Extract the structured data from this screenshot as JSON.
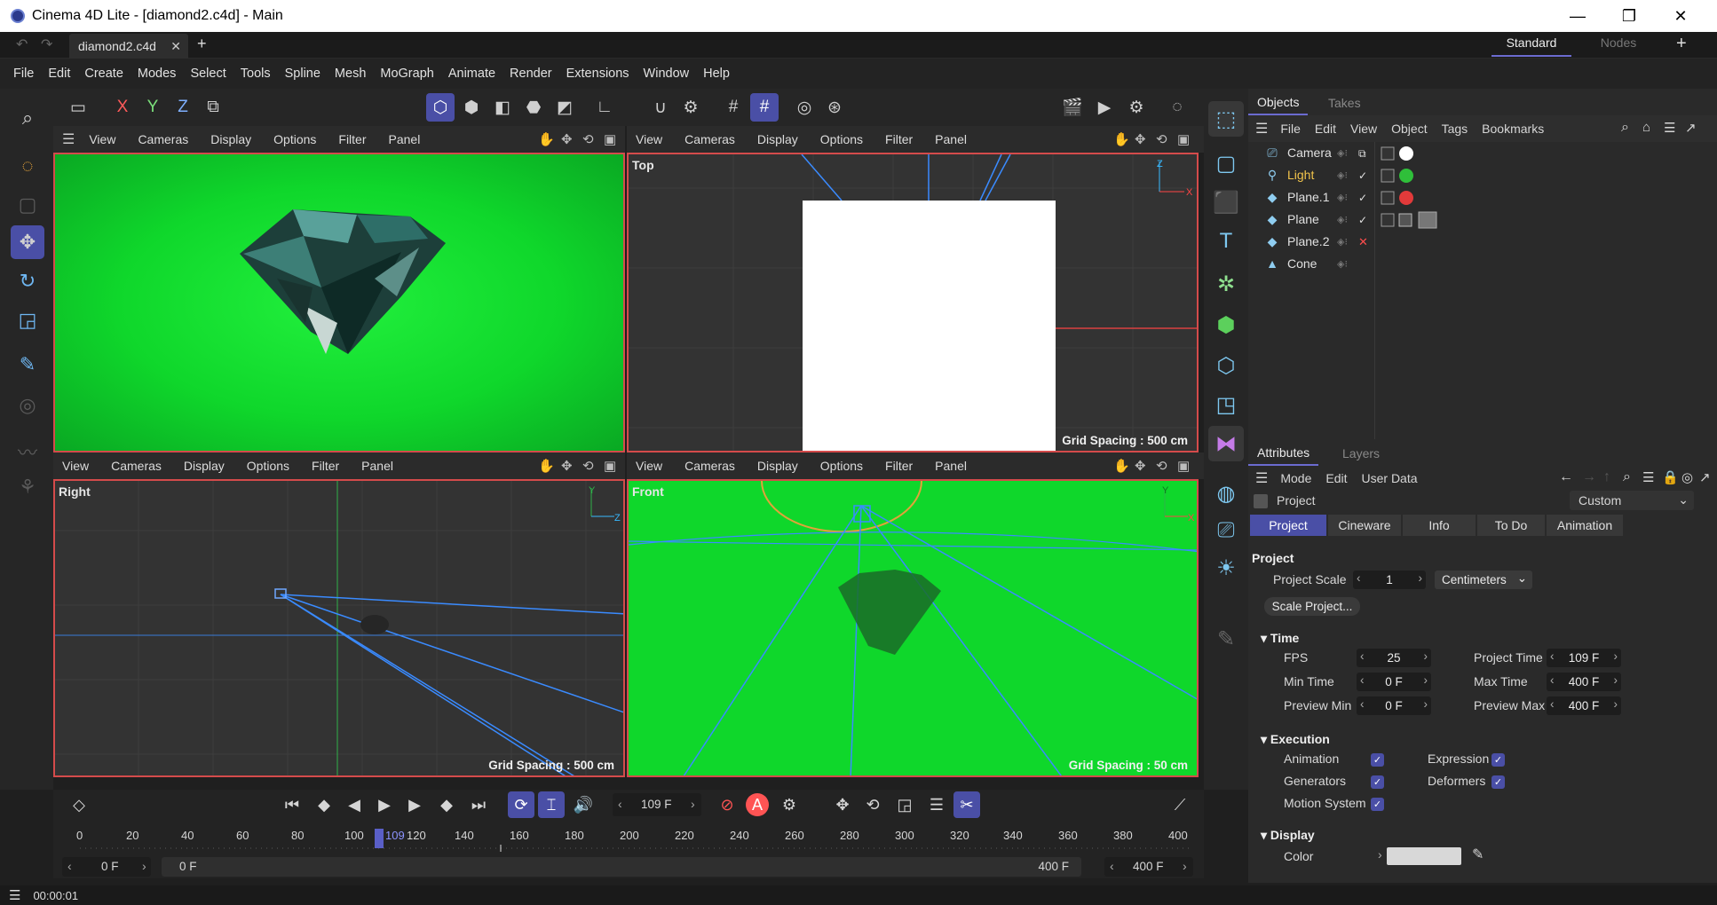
{
  "window": {
    "title": "Cinema 4D Lite - [diamond2.c4d] - Main",
    "minimize": "—",
    "restore": "❐",
    "close": "✕"
  },
  "tabs": {
    "doc": "diamond2.c4d",
    "close": "✕",
    "add": "+",
    "layout_standard": "Standard",
    "layout_nodes": "Nodes",
    "layout_add": "+"
  },
  "menu": [
    "File",
    "Edit",
    "Create",
    "Modes",
    "Select",
    "Tools",
    "Spline",
    "Mesh",
    "MoGraph",
    "Animate",
    "Render",
    "Extensions",
    "Window",
    "Help"
  ],
  "axes": {
    "x": "X",
    "y": "Y",
    "z": "Z"
  },
  "viewport_menu": [
    "View",
    "Cameras",
    "Display",
    "Options",
    "Filter",
    "Panel"
  ],
  "viewports": {
    "top": {
      "label": "Top",
      "grid": "Grid Spacing : 500 cm"
    },
    "right": {
      "label": "Right",
      "grid": "Grid Spacing : 500 cm"
    },
    "front": {
      "label": "Front",
      "grid": "Grid Spacing : 50 cm"
    }
  },
  "timeline": {
    "frame": "109 F",
    "ticks": [
      "0",
      "20",
      "40",
      "60",
      "80",
      "100",
      "120",
      "140",
      "160",
      "180",
      "200",
      "220",
      "240",
      "260",
      "280",
      "300",
      "320",
      "340",
      "360",
      "380",
      "400"
    ],
    "current_marker": "109",
    "start_field": "0 F",
    "range_start": "0 F",
    "range_end": "400 F",
    "end_field": "400 F"
  },
  "status": {
    "time": "00:00:01"
  },
  "objects_panel": {
    "tab_objects": "Objects",
    "tab_takes": "Takes",
    "menu": [
      "File",
      "Edit",
      "View",
      "Object",
      "Tags",
      "Bookmarks"
    ],
    "items": [
      {
        "name": "Camera",
        "icon": "camera-icon"
      },
      {
        "name": "Light",
        "icon": "light-icon"
      },
      {
        "name": "Plane.1",
        "icon": "plane-icon"
      },
      {
        "name": "Plane",
        "icon": "plane-icon"
      },
      {
        "name": "Plane.2",
        "icon": "plane-icon"
      },
      {
        "name": "Cone",
        "icon": "cone-icon"
      }
    ]
  },
  "attributes": {
    "tab_attributes": "Attributes",
    "tab_layers": "Layers",
    "menu": [
      "Mode",
      "Edit",
      "User Data"
    ],
    "object": "Project",
    "preset": "Custom",
    "tabs": [
      "Project",
      "Cineware",
      "Info",
      "To Do",
      "Animation"
    ],
    "section_project": "Project",
    "project_scale_label": "Project Scale",
    "project_scale": "1",
    "unit": "Centimeters",
    "scale_button": "Scale Project...",
    "section_time": "Time",
    "fps_label": "FPS",
    "fps": "25",
    "project_time_label": "Project Time",
    "project_time": "109 F",
    "min_time_label": "Min Time",
    "min_time": "0 F",
    "max_time_label": "Max Time",
    "max_time": "400 F",
    "preview_min_label": "Preview Min",
    "preview_min": "0 F",
    "preview_max_label": "Preview Max",
    "preview_max": "400 F",
    "section_execution": "Execution",
    "animation_label": "Animation",
    "expression_label": "Expression",
    "generators_label": "Generators",
    "deformers_label": "Deformers",
    "motion_label": "Motion System",
    "section_display": "Display",
    "color_label": "Color"
  },
  "colors": {
    "accent": "#4a4fa6",
    "viewport_green": "#0fd72b",
    "highlight_red": "#d44b4b",
    "light_yellow": "#f2c44b"
  }
}
